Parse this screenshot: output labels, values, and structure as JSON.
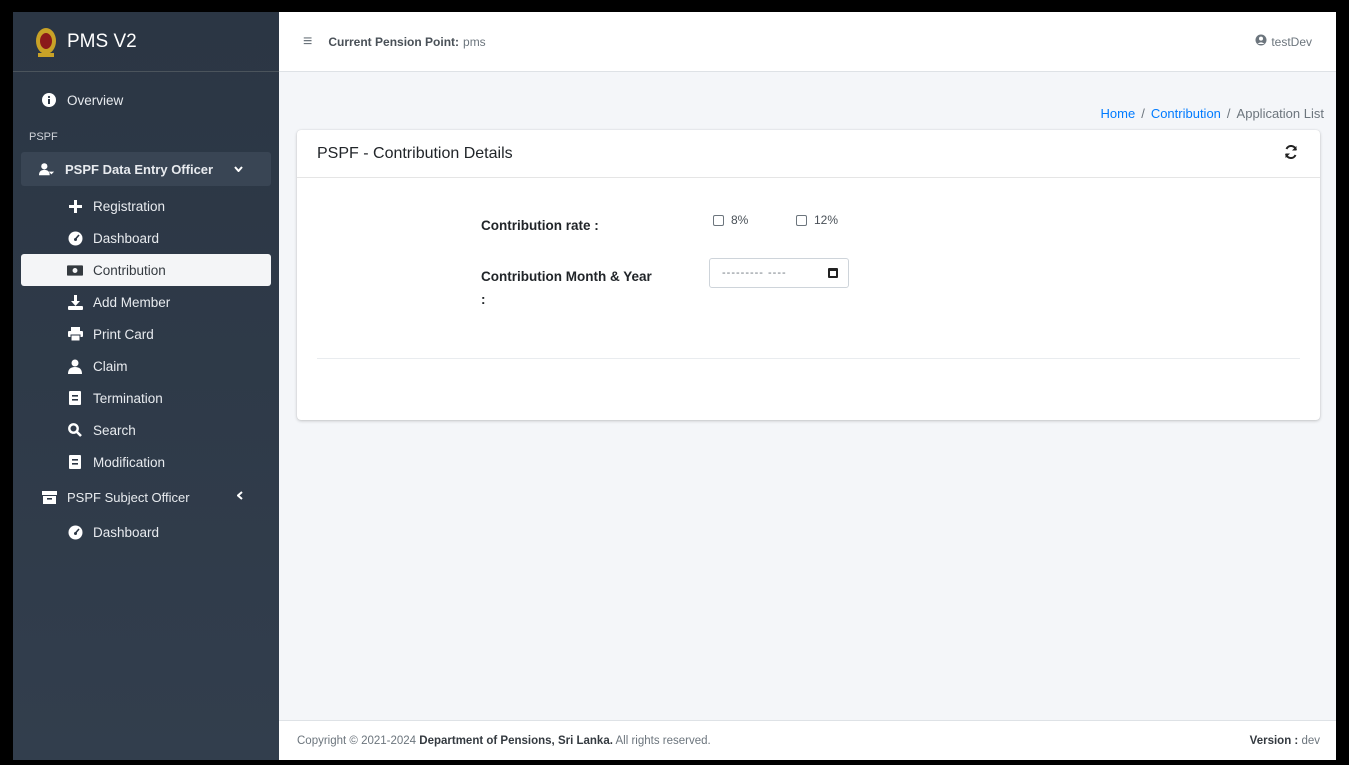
{
  "brand": {
    "title": "PMS V2"
  },
  "sidebar": {
    "overview": "Overview",
    "header": "PSPF",
    "group1": {
      "label": "PSPF Data Entry Officer"
    },
    "items": [
      {
        "label": "Registration",
        "icon": "plus-icon"
      },
      {
        "label": "Dashboard",
        "icon": "tachometer-icon"
      },
      {
        "label": "Contribution",
        "icon": "money-bill-icon"
      },
      {
        "label": "Add Member",
        "icon": "download-icon"
      },
      {
        "label": "Print Card",
        "icon": "print-icon"
      },
      {
        "label": "Claim",
        "icon": "user-shield-icon"
      },
      {
        "label": "Termination",
        "icon": "file-icon"
      },
      {
        "label": "Search",
        "icon": "search-icon"
      },
      {
        "label": "Modification",
        "icon": "file-icon"
      }
    ],
    "group2": {
      "label": "PSPF Subject Officer"
    },
    "group2_items": [
      {
        "label": "Dashboard",
        "icon": "tachometer-icon"
      }
    ]
  },
  "topbar": {
    "label": "Current Pension Point:",
    "value": "pms",
    "user": "testDev"
  },
  "breadcrumb": {
    "home": "Home",
    "section": "Contribution",
    "current": "Application List"
  },
  "card": {
    "title": "PSPF - Contribution Details",
    "rate_label": "Contribution rate :",
    "rate_options": [
      "8%",
      "12%"
    ],
    "month_label_line1": "Contribution Month & Year",
    "month_label_line2": ":",
    "month_placeholder": "--------- ----"
  },
  "footer": {
    "prefix": "Copyright © 2021-2024",
    "org": "Department of Pensions, Sri Lanka.",
    "suffix": "All rights reserved.",
    "version_label": "Version :",
    "version_value": "dev"
  },
  "colors": {
    "sidebar_bg": "#2b3644",
    "link": "#007bff",
    "active_bg": "#f4f5f7"
  }
}
